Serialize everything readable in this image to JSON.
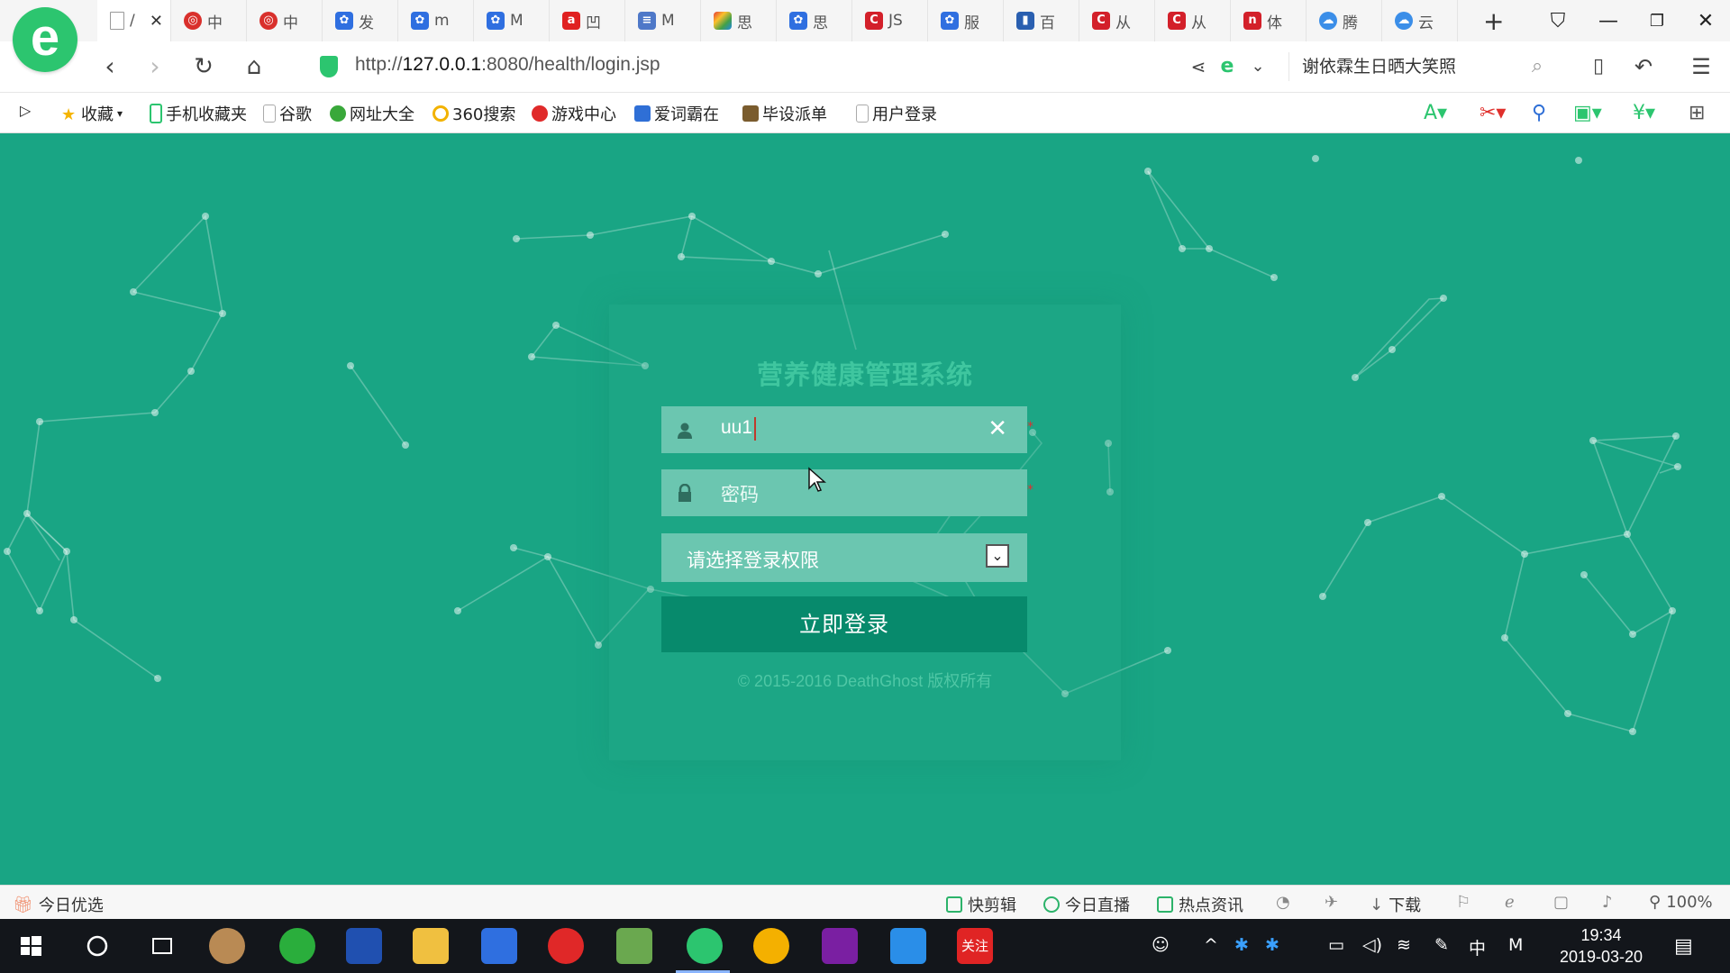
{
  "browser": {
    "logo": "e",
    "tabs": [
      {
        "label": "/",
        "icon": "page-icon",
        "active": true
      },
      {
        "label": "中",
        "icon": "target-icon"
      },
      {
        "label": "中",
        "icon": "target-icon"
      },
      {
        "label": "发",
        "icon": "paw-icon"
      },
      {
        "label": "m",
        "icon": "paw-icon"
      },
      {
        "label": "M",
        "icon": "paw-icon"
      },
      {
        "label": "凹",
        "icon": "a-icon"
      },
      {
        "label": "M",
        "icon": "doc-icon"
      },
      {
        "label": "思",
        "icon": "colorful-icon"
      },
      {
        "label": "思",
        "icon": "paw-icon"
      },
      {
        "label": "JS",
        "icon": "c-icon"
      },
      {
        "label": "服",
        "icon": "paw-icon"
      },
      {
        "label": "百",
        "icon": "bars-icon"
      },
      {
        "label": "从",
        "icon": "c-icon"
      },
      {
        "label": "从",
        "icon": "c-icon"
      },
      {
        "label": "体",
        "icon": "h-icon"
      },
      {
        "label": "腾",
        "icon": "cloud-icon"
      },
      {
        "label": "云",
        "icon": "cloud-icon"
      }
    ],
    "new_tab": "+",
    "url_prefix": "http://",
    "url_host": "127.0.0.1",
    "url_rest": ":8080/health/login.jsp",
    "search_text": "谢依霖生日晒大笑照",
    "bookmarks": [
      {
        "label": "收藏",
        "color": "#f5b400"
      },
      {
        "label": "手机收藏夹",
        "color": "#2cc56f"
      },
      {
        "label": "谷歌",
        "color": "#bbbbbb"
      },
      {
        "label": "网址大全",
        "color": "#39a83a"
      },
      {
        "label": "360搜索",
        "color": "#f2b200"
      },
      {
        "label": "游戏中心",
        "color": "#e02a2a"
      },
      {
        "label": "爱词霸在",
        "color": "#2f6fd6"
      },
      {
        "label": "毕设派单",
        "color": "#7a5c2e"
      },
      {
        "label": "用户登录",
        "color": "#bbbbbb"
      }
    ]
  },
  "login": {
    "title": "营养健康管理系统",
    "username_value": "uu1",
    "clear_symbol": "✕",
    "password_placeholder": "密码",
    "role_placeholder": "请选择登录权限",
    "required_mark": "*",
    "submit_label": "立即登录",
    "copyright": "© 2015-2016 DeathGhost 版权所有"
  },
  "statusbar": {
    "left": "今日优选",
    "items": [
      "快剪辑",
      "今日直播",
      "热点资讯",
      "下载"
    ],
    "zoom": "100%"
  },
  "taskbar": {
    "time": "19:34",
    "date": "2019-03-20",
    "ime": "中",
    "ime2": "M",
    "active_app_label": "关注"
  },
  "colors": {
    "page_bg": "#19a584",
    "field_bg": "#6bc6b0",
    "button_bg": "#078a6c",
    "title_color": "#3fc69f"
  }
}
